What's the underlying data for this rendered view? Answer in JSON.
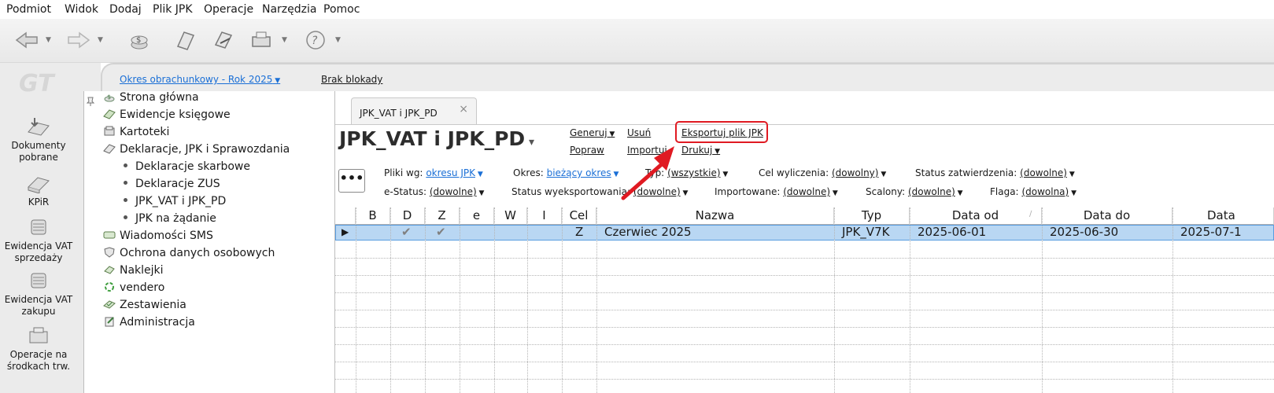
{
  "menu": [
    "Podmiot",
    "Widok",
    "Dodaj",
    "Plik JPK",
    "Operacje",
    "Narzędzia",
    "Pomoc"
  ],
  "period": {
    "label": "Okres obrachunkowy - Rok 2025",
    "lock": "Brak blokady"
  },
  "leftbar": [
    {
      "label": "Dokumenty pobrane"
    },
    {
      "label": "KPiR"
    },
    {
      "label": "Ewidencja VAT sprzedaży"
    },
    {
      "label": "Ewidencja VAT zakupu"
    },
    {
      "label": "Operacje na środkach trw."
    }
  ],
  "tree": [
    {
      "label": "Strona główna"
    },
    {
      "label": "Ewidencje księgowe"
    },
    {
      "label": "Kartoteki"
    },
    {
      "label": "Deklaracje, JPK i Sprawozdania"
    },
    {
      "label": "Deklaracje skarbowe"
    },
    {
      "label": "Deklaracje ZUS"
    },
    {
      "label": "JPK_VAT i JPK_PD"
    },
    {
      "label": "JPK na żądanie"
    },
    {
      "label": "Wiadomości SMS"
    },
    {
      "label": "Ochrona danych osobowych"
    },
    {
      "label": "Naklejki"
    },
    {
      "label": "vendero"
    },
    {
      "label": "Zestawienia"
    },
    {
      "label": "Administracja"
    }
  ],
  "tab": {
    "label": "JPK_VAT i JPK_PD",
    "close": "×"
  },
  "doc": {
    "title": "JPK_VAT i JPK_PD",
    "actions": {
      "generuj": "Generuj",
      "usun": "Usuń",
      "eksportuj": "Eksportuj plik JPK",
      "popraw": "Popraw",
      "importuj": "Importuj",
      "drukuj": "Drukuj"
    }
  },
  "filters": {
    "dots": "•••",
    "pliki_label": "Pliki wg:",
    "pliki_value": "okresu JPK",
    "okres_label": "Okres:",
    "okres_value": "bieżący okres",
    "typ_label": "Typ:",
    "typ_value": "(wszystkie)",
    "cel_label": "Cel wyliczenia:",
    "cel_value": "(dowolny)",
    "zatw_label": "Status zatwierdzenia:",
    "zatw_value": "(dowolne)",
    "estatus_label": "e-Status:",
    "estatus_value": "(dowolne)",
    "wyeksp_label": "Status wyeksportowania:",
    "wyeksp_value": "(dowolne)",
    "import_label": "Importowane:",
    "import_value": "(dowolne)",
    "scalony_label": "Scalony:",
    "scalony_value": "(dowolne)",
    "flaga_label": "Flaga:",
    "flaga_value": "(dowolna)"
  },
  "grid": {
    "columns": [
      "B",
      "D",
      "Z",
      "e",
      "W",
      "I",
      "Cel",
      "Nazwa",
      "Typ",
      "Data od",
      "Data do",
      "Data"
    ],
    "rows": [
      {
        "b": "",
        "d": "✔",
        "z": "✔",
        "e": "",
        "w": "",
        "i": "",
        "cel": "Z",
        "nazwa": "Czerwiec 2025",
        "typ": "JPK_V7K",
        "data_od": "2025-06-01",
        "data_do": "2025-06-30",
        "data": "2025-07-1"
      }
    ]
  }
}
